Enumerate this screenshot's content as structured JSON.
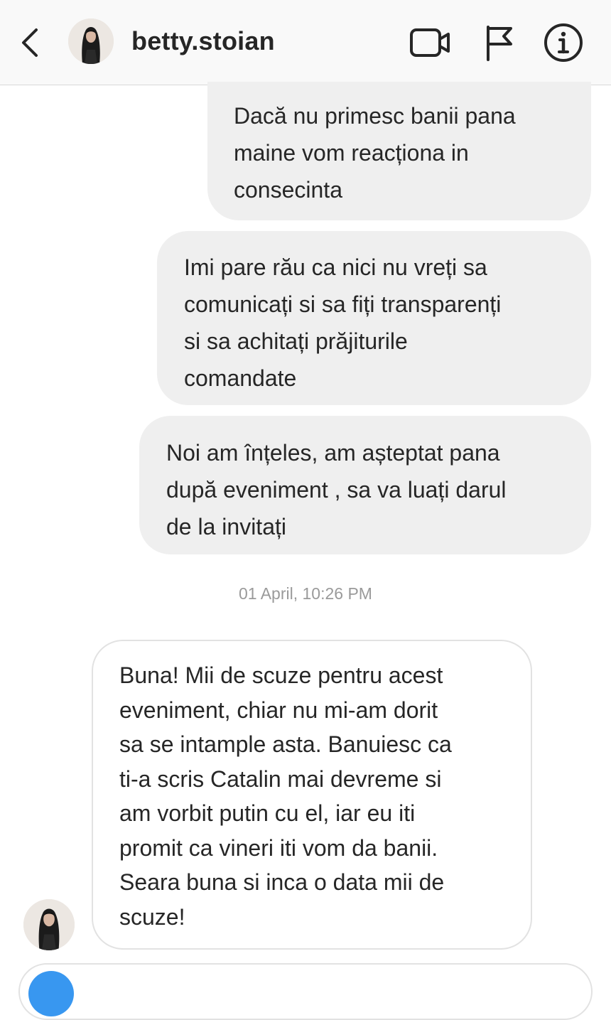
{
  "header": {
    "username": "betty.stoian",
    "icons": {
      "back": "chevron-left-icon",
      "video": "video-camera-icon",
      "report": "flag-icon",
      "info": "info-icon"
    }
  },
  "messages": {
    "outgoing": [
      {
        "text": "Dacă nu primesc banii pana\nmaine vom reacționa in\nconsecinta"
      },
      {
        "text": "Imi pare rău ca nici nu vreți sa\ncomunicați si sa fiți transparenți\nsi sa achitați prăjiturile\ncomandate"
      },
      {
        "text": "Noi am înțeles, am așteptat pana\ndupă eveniment , sa va luați darul\nde la invitați"
      }
    ],
    "timestamp": "01 April, 10:26 PM",
    "incoming": [
      {
        "text": "Buna! Mii de scuze pentru acest\neveniment, chiar nu mi-am dorit\nsa se intample asta. Banuiesc ca\nti-a scris Catalin mai devreme si\nam vorbit putin cu el, iar eu iti\npromit ca vineri iti vom da banii.\nSeara buna si inca o data mii de\nscuze!"
      }
    ]
  },
  "colors": {
    "outgoing_bubble": "#efefef",
    "incoming_border": "#e2e2e2",
    "timestamp": "#9a9a9a",
    "accent_blue": "#3897f0"
  }
}
